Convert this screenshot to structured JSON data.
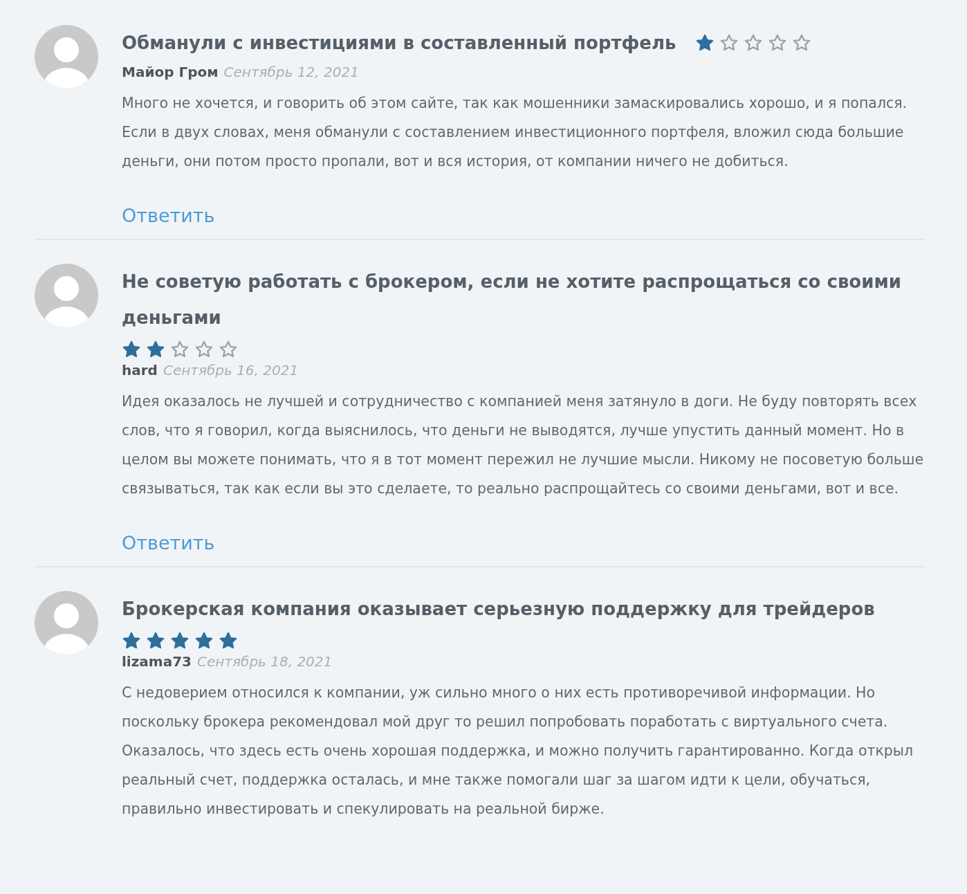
{
  "reviews": [
    {
      "title": "Обманули с инвестициями в составленный портфель",
      "stars": 1,
      "author": "Майор Гром",
      "date": "Сентябрь 12, 2021",
      "text": "Много не хочется, и говорить об этом сайте, так как мошенники замаскировались хорошо, и я попался. Если в двух словах, меня обманули с составлением инвестиционного портфеля, вложил сюда большие деньги, они потом просто пропали, вот и вся история, от компании ничего не добиться.",
      "reply": "Ответить"
    },
    {
      "title": "Не советую работать с брокером, если не хотите распрощаться со своими деньгами",
      "stars": 2,
      "author": "hard",
      "date": "Сентябрь 16, 2021",
      "text": "Идея оказалось не лучшей и сотрудничество с компанией меня затянуло в доги. Не буду повторять всех слов, что я говорил, когда выяснилось, что деньги не выводятся, лучше упустить данный момент. Но в целом вы можете понимать, что я в тот момент пережил не лучшие мысли. Никому не посоветую больше связываться, так как если вы это сделаете, то реально распрощайтесь со своими деньгами, вот и все.",
      "reply": "Ответить"
    },
    {
      "title": "Брокерская компания оказывает серьезную поддержку для трейдеров",
      "stars": 5,
      "author": "lizama73",
      "date": "Сентябрь 18, 2021",
      "text": "С недоверием относился к компании, уж сильно много о них есть противоречивой информации. Но поскольку брокера рекомендовал мой друг то решил попробовать поработать с виртуального счета. Оказалось, что здесь есть очень хорошая поддержка, и можно получить гарантированно. Когда открыл реальный счет, поддержка осталась, и мне также помогали шаг за шагом идти к цели, обучаться, правильно инвестировать и спекулировать на реальной бирже."
    }
  ]
}
